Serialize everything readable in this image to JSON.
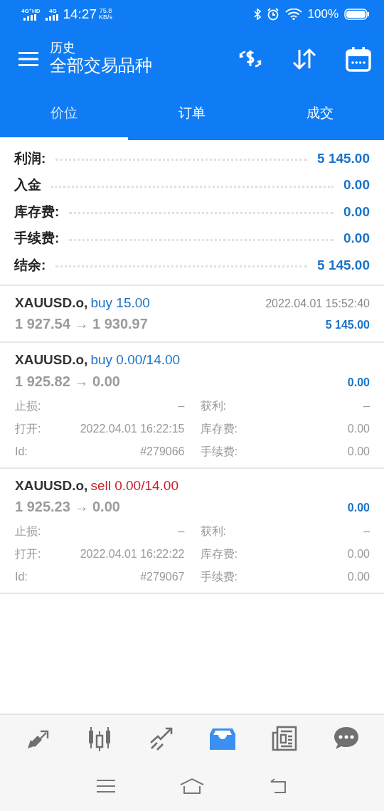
{
  "status_bar": {
    "network_1": "4G⁺HD",
    "network_2": "4G",
    "time": "14:27",
    "speed": "75.8",
    "speed_unit": "KB/s",
    "battery_text": "100%"
  },
  "header": {
    "subtitle": "历史",
    "title": "全部交易品种"
  },
  "tabs": [
    {
      "label": "价位",
      "selected": true
    },
    {
      "label": "订单",
      "selected": false
    },
    {
      "label": "成交",
      "selected": false
    }
  ],
  "summary": [
    {
      "label": "利润:",
      "value": "5 145.00"
    },
    {
      "label": "入金",
      "value": "0.00"
    },
    {
      "label": "库存费:",
      "value": "0.00"
    },
    {
      "label": "手续费:",
      "value": "0.00"
    },
    {
      "label": "结余:",
      "value": "5 145.00"
    }
  ],
  "deals": [
    {
      "symbol": "XAUUSD.o,",
      "kind": "buy",
      "order": "buy 15.00",
      "prices": "1 927.54 → 1 930.97",
      "time": "2022.04.01 15:52:40",
      "profit": "5 145.00"
    },
    {
      "symbol": "XAUUSD.o,",
      "kind": "buy",
      "order": "buy 0.00/14.00",
      "prices": "1 925.82 → 0.00",
      "profit": "0.00",
      "details": [
        {
          "label": "止损:",
          "value": "–"
        },
        {
          "label": "获利:",
          "value": "–"
        },
        {
          "label": "打开:",
          "value": "2022.04.01 16:22:15"
        },
        {
          "label": "库存费:",
          "value": "0.00"
        },
        {
          "label": "Id:",
          "value": "#279066"
        },
        {
          "label": "手续费:",
          "value": "0.00"
        }
      ]
    },
    {
      "symbol": "XAUUSD.o,",
      "kind": "sell",
      "order": "sell 0.00/14.00",
      "prices": "1 925.23 → 0.00",
      "profit": "0.00",
      "details": [
        {
          "label": "止损:",
          "value": "–"
        },
        {
          "label": "获利:",
          "value": "–"
        },
        {
          "label": "打开:",
          "value": "2022.04.01 16:22:22"
        },
        {
          "label": "库存费:",
          "value": "0.00"
        },
        {
          "label": "Id:",
          "value": "#279067"
        },
        {
          "label": "手续费:",
          "value": "0.00"
        }
      ]
    }
  ],
  "bottom_nav": [
    {
      "selected": false
    },
    {
      "selected": false
    },
    {
      "selected": false
    },
    {
      "selected": true
    },
    {
      "selected": false
    },
    {
      "selected": false
    }
  ]
}
